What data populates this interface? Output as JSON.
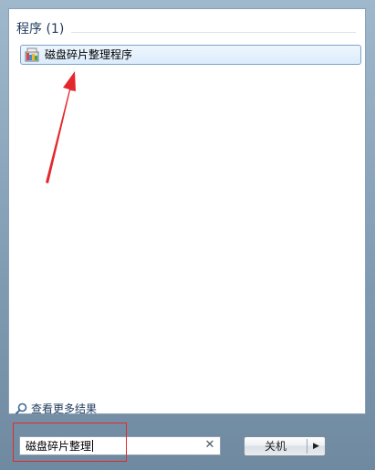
{
  "results": {
    "group_title": "程序 (1)",
    "items": [
      {
        "label": "磁盘碎片整理程序",
        "icon": "defrag-icon"
      }
    ]
  },
  "see_more": {
    "label": "查看更多结果",
    "icon": "search-icon"
  },
  "search": {
    "value": "磁盘碎片整理",
    "clear_icon": "clear-icon"
  },
  "shutdown": {
    "label": "关机",
    "arrow_icon": "triangle-right-icon"
  },
  "annotations": {
    "color": "#e3282d"
  }
}
